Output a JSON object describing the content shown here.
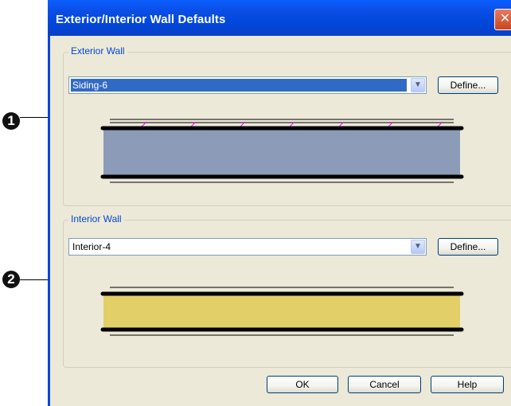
{
  "callouts": {
    "one": "1",
    "two": "2"
  },
  "dialog": {
    "title": "Exterior/Interior Wall Defaults",
    "close_glyph": "✕",
    "exterior": {
      "group_label": "Exterior Wall",
      "selected_value": "Siding-6",
      "define_label": "Define...",
      "fill_color": "#8b9bb8",
      "siding_tick_color": "#ff00ff"
    },
    "interior": {
      "group_label": "Interior Wall",
      "selected_value": "Interior-4",
      "define_label": "Define...",
      "fill_color": "#e2cf67"
    },
    "buttons": {
      "ok": "OK",
      "cancel": "Cancel",
      "help": "Help"
    }
  }
}
